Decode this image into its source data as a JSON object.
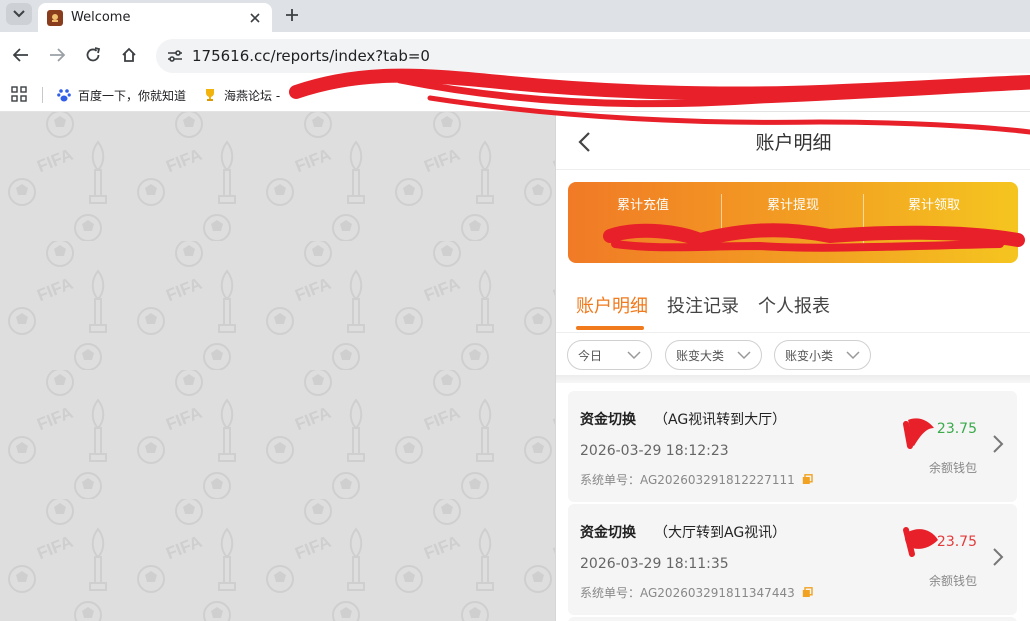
{
  "browser": {
    "tab_title": "Welcome",
    "url": "175616.cc/reports/index?tab=0",
    "bookmarks": [
      {
        "label": "百度一下，你就知道",
        "icon": "baidu-paw-icon"
      },
      {
        "label": "海燕论坛 -",
        "icon": "trophy-icon"
      }
    ]
  },
  "page": {
    "title": "账户明细",
    "summary": {
      "deposit_label": "累计充值",
      "withdraw_label": "累计提现",
      "claim_label": "累计领取"
    },
    "tabs": [
      {
        "label": "账户明细",
        "active": true
      },
      {
        "label": "投注记录",
        "active": false
      },
      {
        "label": "个人报表",
        "active": false
      }
    ],
    "filters": [
      {
        "label": "今日"
      },
      {
        "label": "账变大类"
      },
      {
        "label": "账变小类"
      }
    ],
    "records": [
      {
        "title": "资金切换",
        "subtitle": "（AG视讯转到大厅）",
        "time": "2026-03-29 18:12:23",
        "order": "系统单号：AG202603291812227111",
        "amount": "23.75",
        "amount_color": "#3aaa4a",
        "wallet": "余额钱包"
      },
      {
        "title": "资金切换",
        "subtitle": "（大厅转到AG视讯）",
        "time": "2026-03-29 18:11:35",
        "order": "系统单号：AG202603291811347443",
        "amount": "23.75",
        "amount_color": "#e33b3b",
        "wallet": "余额钱包"
      }
    ]
  },
  "colors": {
    "accent": "#f17a1c",
    "summary_gradient": [
      "#f17a26",
      "#f5c51f"
    ],
    "redaction": "#e8202a"
  }
}
